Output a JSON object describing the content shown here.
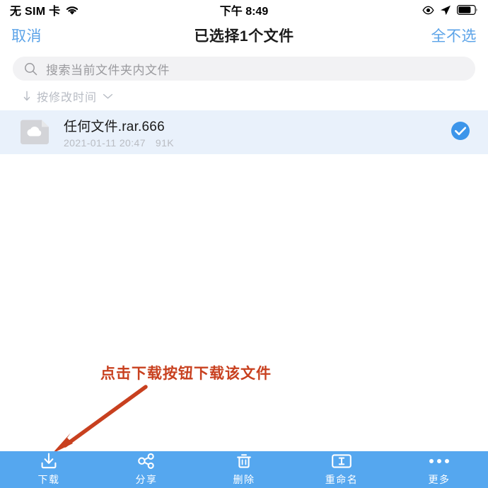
{
  "status_bar": {
    "carrier": "无 SIM 卡",
    "wifi_icon": "wifi-icon",
    "time": "下午 8:49",
    "eye_icon": "eye-icon",
    "location_icon": "location-arrow-icon",
    "battery_icon": "battery-icon"
  },
  "nav_bar": {
    "cancel_label": "取消",
    "title": "已选择1个文件",
    "deselect_all_label": "全不选",
    "link_color": "#5ba3e8"
  },
  "search": {
    "placeholder": "搜索当前文件夹内文件",
    "value": "",
    "icon": "search-icon"
  },
  "sort": {
    "direction_icon": "arrow-down-icon",
    "label": "按修改时间",
    "chevron_icon": "chevron-down-icon"
  },
  "file_list": {
    "items": [
      {
        "icon": "cloud-file-icon",
        "name": "任何文件.rar.666",
        "modified": "2021-01-11 20:47",
        "size": "91K",
        "selected": true,
        "check_icon": "check-circle-icon"
      }
    ],
    "selected_row_color": "#e9f1fb"
  },
  "annotation": {
    "text": "点击下载按钮下载该文件",
    "color": "#c8401f",
    "arrow_icon": "arrow-pointer-icon"
  },
  "toolbar": {
    "background": "#55a7ef",
    "items": [
      {
        "icon": "download-icon",
        "label": "下载"
      },
      {
        "icon": "share-nodes-icon",
        "label": "分享"
      },
      {
        "icon": "trash-icon",
        "label": "删除"
      },
      {
        "icon": "rename-icon",
        "label": "重命名"
      },
      {
        "icon": "ellipsis-icon",
        "label": "更多"
      }
    ]
  }
}
